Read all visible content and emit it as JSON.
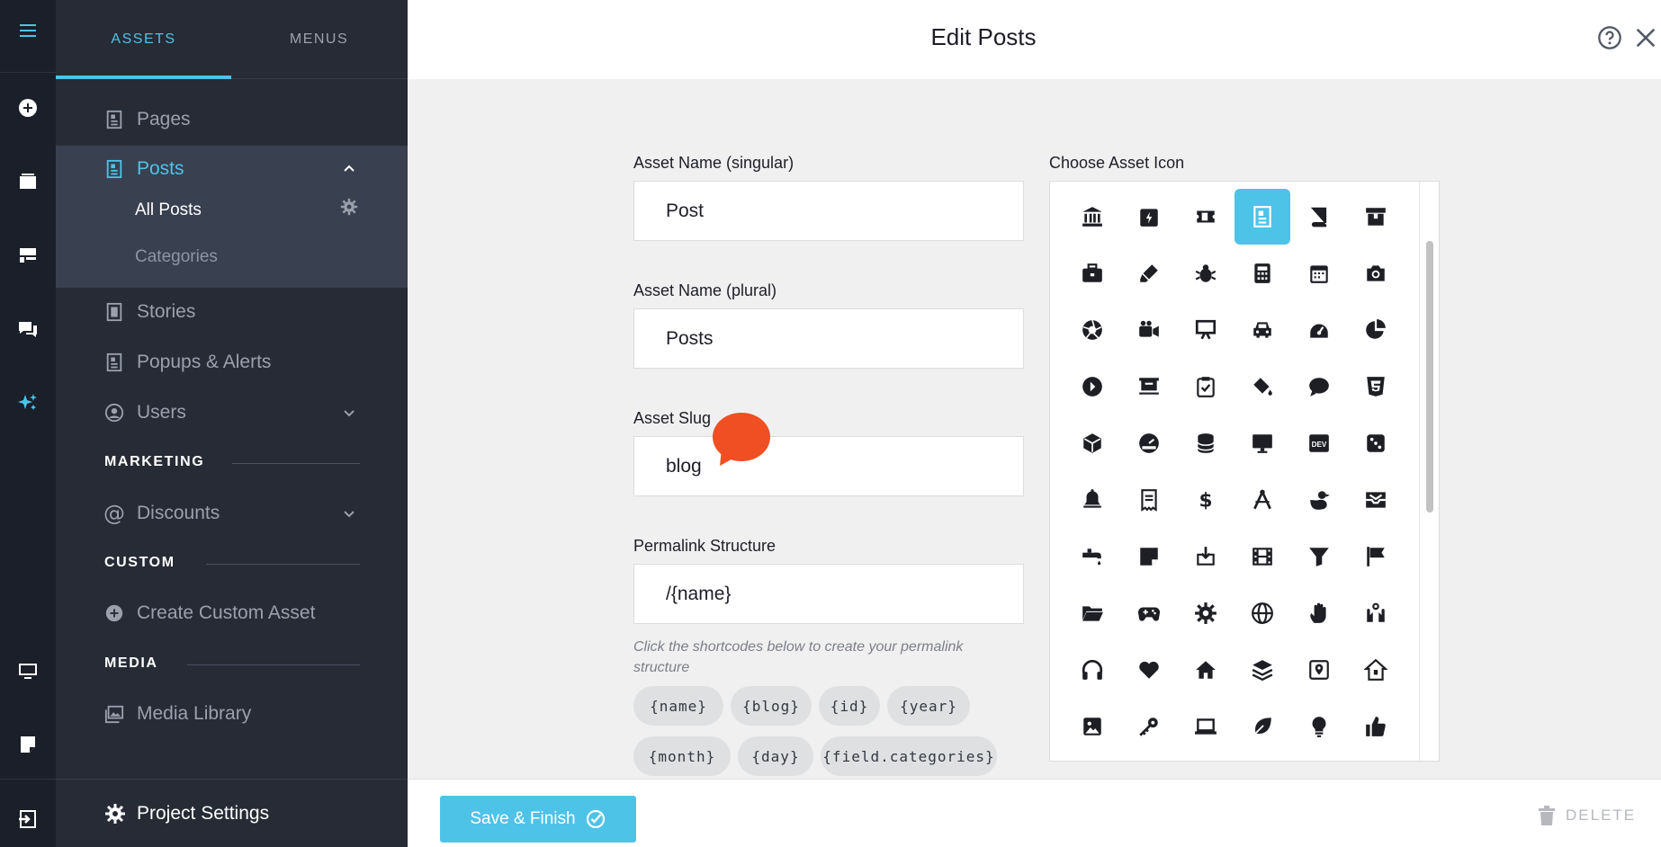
{
  "sidebar": {
    "tabs": [
      {
        "label": "ASSETS"
      },
      {
        "label": "MENUS"
      }
    ],
    "items": {
      "pages": "Pages",
      "posts": "Posts",
      "stories": "Stories",
      "popups": "Popups & Alerts",
      "users": "Users",
      "discounts": "Discounts",
      "create_custom": "Create Custom Asset",
      "media_library": "Media Library"
    },
    "posts_sub": {
      "all_posts": "All Posts",
      "categories": "Categories"
    },
    "sections": {
      "marketing": "MARKETING",
      "custom": "CUSTOM",
      "media": "MEDIA"
    },
    "project_settings": "Project Settings"
  },
  "header": {
    "title": "Edit Posts"
  },
  "form": {
    "singular_label": "Asset Name (singular)",
    "singular_value": "Post",
    "plural_label": "Asset Name (plural)",
    "plural_value": "Posts",
    "slug_label": "Asset Slug",
    "slug_value": "blog",
    "permalink_label": "Permalink Structure",
    "permalink_value": "/{name}",
    "permalink_hint": "Click the shortcodes below to create your permalink structure",
    "shortcodes": [
      "{name}",
      "{blog}",
      "{id}",
      "{year}",
      "{month}",
      "{day}",
      "{field.categories}"
    ]
  },
  "icon_chooser": {
    "label": "Choose Asset Icon",
    "selected": "post-icon",
    "icons": [
      "bank-icon",
      "calendar-bolt-icon",
      "ticket-icon",
      "post-icon",
      "book-icon",
      "archive-icon",
      "briefcase-icon",
      "highlighter-icon",
      "bug-icon",
      "calculator-icon",
      "calendar-icon",
      "camera-icon",
      "aperture-icon",
      "video-camera-icon",
      "easel-icon",
      "car-icon",
      "gauge-icon",
      "pie-chart-icon",
      "play-circle-icon",
      "presentation-icon",
      "clipboard-check-icon",
      "paint-bucket-icon",
      "chat-bubble-icon",
      "css3-icon",
      "cube-icon",
      "dashboard-icon",
      "database-icon",
      "monitor-icon",
      "dev-badge-icon",
      "dice-icon",
      "bell-icon",
      "receipt-icon",
      "dollar-icon",
      "drafting-compass-icon",
      "duck-icon",
      "inbox-icon",
      "faucet-icon",
      "sticky-note-icon",
      "download-box-icon",
      "film-icon",
      "filter-icon",
      "flag-icon",
      "folder-open-icon",
      "gamepad-icon",
      "gear-icon",
      "globe-icon",
      "hand-icon",
      "hands-icon",
      "headphones-icon",
      "heart-icon",
      "home-icon",
      "layers-icon",
      "map-marker-icon",
      "house-outline-icon",
      "image-icon",
      "key-icon",
      "laptop-icon",
      "leaf-icon",
      "lightbulb-icon",
      "thumbs-up-icon"
    ]
  },
  "footer": {
    "save_label": "Save & Finish",
    "delete_label": "DELETE"
  },
  "colors": {
    "accent": "#4ec3e8",
    "sidebar_bg": "#262b36",
    "rail_bg": "#1b1f29",
    "chat_bubble": "#f04e23"
  }
}
